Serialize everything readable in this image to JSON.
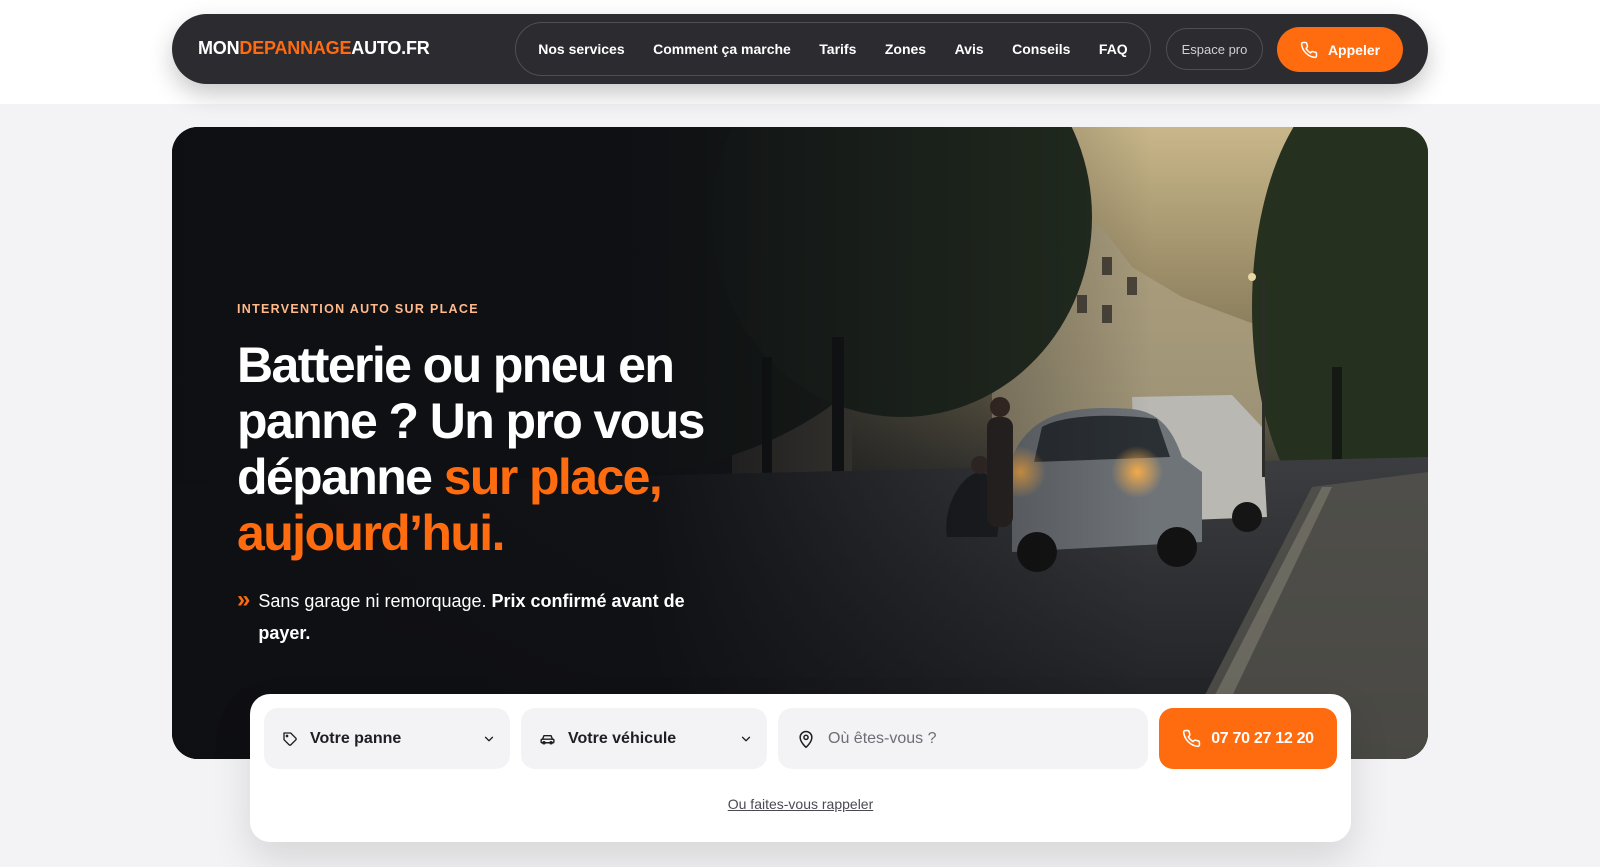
{
  "header": {
    "logo": {
      "part1": "MON",
      "part2": "DEPANNAGE",
      "part3": "AUTO.FR"
    },
    "nav": [
      {
        "label": "Nos services"
      },
      {
        "label": "Comment ça marche"
      },
      {
        "label": "Tarifs"
      },
      {
        "label": "Zones"
      },
      {
        "label": "Avis"
      },
      {
        "label": "Conseils"
      },
      {
        "label": "FAQ"
      }
    ],
    "pro_label": "Espace pro",
    "call_label": "Appeler",
    "call_icon": "phone-icon"
  },
  "hero": {
    "eyebrow": "INTERVENTION AUTO SUR PLACE",
    "headline_main": "Batterie ou pneu en panne ? Un pro vous dépanne ",
    "headline_accent": "sur place, aujourd’hui.",
    "sub_prefix": "»",
    "sub_plain": "Sans garage ni remorquage. ",
    "sub_bold": "Prix confirmé avant de payer.",
    "image_alt": "street-roadside-assistance-photo"
  },
  "search": {
    "panne_label": "Votre panne",
    "panne_icon": "tag-icon",
    "vehicule_label": "Votre véhicule",
    "vehicule_icon": "car-icon",
    "location_placeholder": "Où êtes-vous ?",
    "location_value": "",
    "location_icon": "map-pin-icon",
    "phone_label": "07 70 27 12 20",
    "callback_label": "Ou faites-vous rappeler"
  },
  "colors": {
    "accent": "#ff6b0f",
    "nav_bg": "#2b2b30",
    "eyebrow": "#ffb98a"
  }
}
